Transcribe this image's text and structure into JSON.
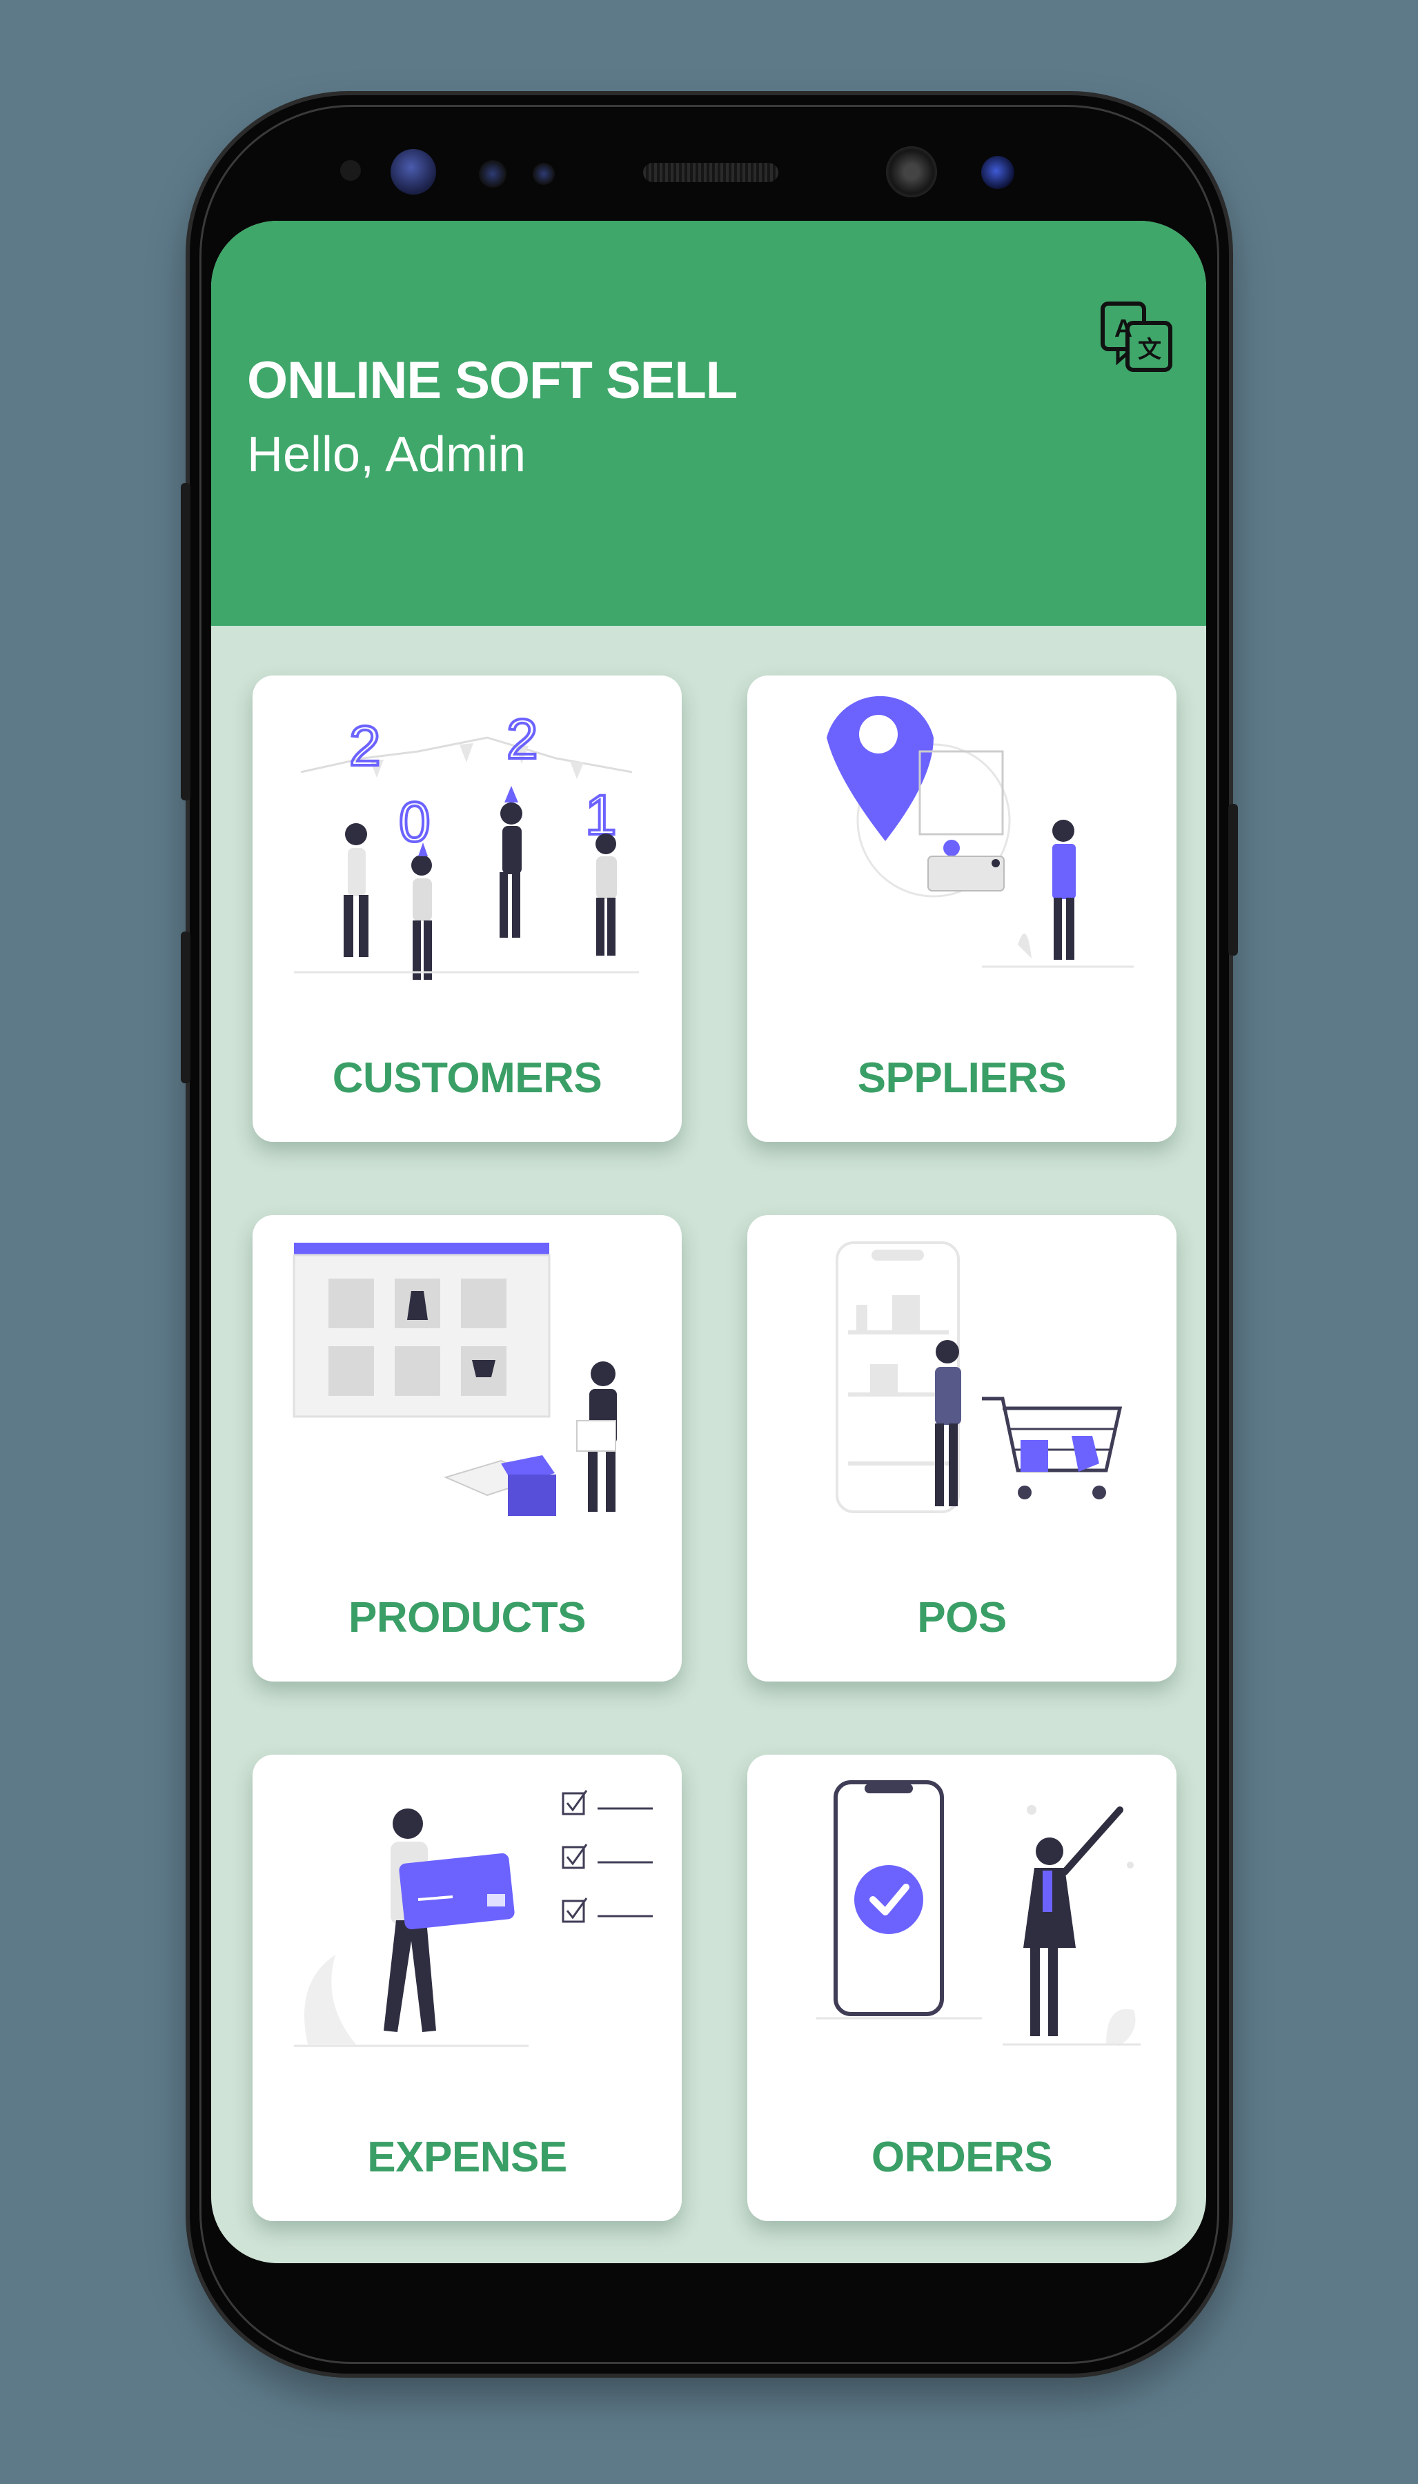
{
  "header": {
    "app_title": "ONLINE SOFT SELL",
    "greeting": "Hello, Admin",
    "translate_icon": "translate-icon"
  },
  "menu": {
    "items": [
      {
        "label": "CUSTOMERS",
        "illustration": "party-people-illustration"
      },
      {
        "label": "SPPLIERS",
        "illustration": "location-delivery-illustration"
      },
      {
        "label": "PRODUCTS",
        "illustration": "product-boxes-illustration"
      },
      {
        "label": "POS",
        "illustration": "shopping-cart-illustration"
      },
      {
        "label": "EXPENSE",
        "illustration": "credit-card-checklist-illustration"
      },
      {
        "label": "ORDERS",
        "illustration": "phone-confirmed-illustration"
      }
    ]
  },
  "colors": {
    "header_green": "#3fa76a",
    "screen_bg": "#cfe3d6",
    "label_green": "#3a9f66",
    "accent_purple": "#6c63ff",
    "page_bg": "#5e7a89"
  }
}
